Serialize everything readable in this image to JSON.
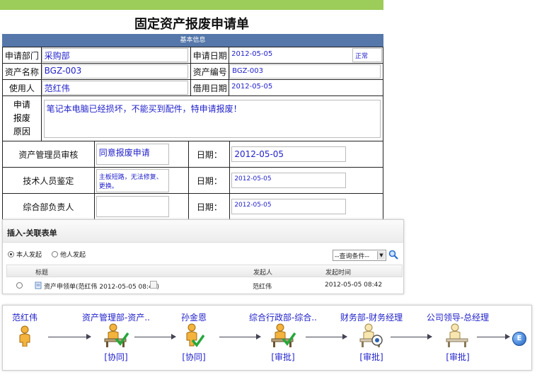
{
  "form": {
    "title": "固定资产报废申请单",
    "section": "基本信息",
    "dept_label": "申请部门",
    "dept_value": "采购部",
    "apply_date_label": "申请日期",
    "apply_date_value": "2012-05-05",
    "status_value": "正常",
    "asset_name_label": "资产名称",
    "asset_name_value": "BGZ-003",
    "asset_no_label": "资产编号",
    "asset_no_value": "BGZ-003",
    "user_label": "使用人",
    "user_value": "范红伟",
    "borrow_date_label": "借用日期",
    "borrow_date_value": "2012-05-05",
    "reason_label_lines": [
      "申请",
      "报废",
      "原因"
    ],
    "reason_value": "笔记本电脑已经损坏，不能买到配件，特申请报废！"
  },
  "approvals": [
    {
      "label": "资产管理员审核",
      "opinion": "同意报废申请",
      "date_label": "日期：",
      "date": "2012-05-05"
    },
    {
      "label": "技术人员鉴定",
      "opinion": "主板短路，无法修复、更换。",
      "date_label": "日期：",
      "date": "2012-05-05"
    },
    {
      "label": "综合部负责人",
      "opinion": "",
      "date_label": "日期：",
      "date": "2012-05-05"
    }
  ],
  "popup": {
    "title": "插入-关联表单",
    "radio_self": "本人发起",
    "radio_other": "他人发起",
    "select_value": "--查询条件--",
    "col_title": "标题",
    "col_initiator": "发起人",
    "col_time": "发起时间",
    "row_title": "资产申领单(范红伟 2012-05-05 08:41)",
    "row_initiator": "范红伟",
    "row_time": "2012-05-05 08:42"
  },
  "flow": {
    "steps": [
      {
        "name": "范红伟",
        "tag": "",
        "icon": "person-icon"
      },
      {
        "name": "资产管理部-资产..",
        "tag": "[协同]",
        "icon": "desk-worker-check-icon"
      },
      {
        "name": "孙金恩",
        "tag": "[协同]",
        "icon": "person-check-icon"
      },
      {
        "name": "综合行政部-综合..",
        "tag": "[审批]",
        "icon": "desk-worker-check-icon"
      },
      {
        "name": "财务部-财务经理",
        "tag": "[审批]",
        "icon": "desk-worker-eye-icon"
      },
      {
        "name": "公司领导-总经理",
        "tag": "[审批]",
        "icon": "desk-worker-icon"
      }
    ],
    "end_label": "E"
  }
}
